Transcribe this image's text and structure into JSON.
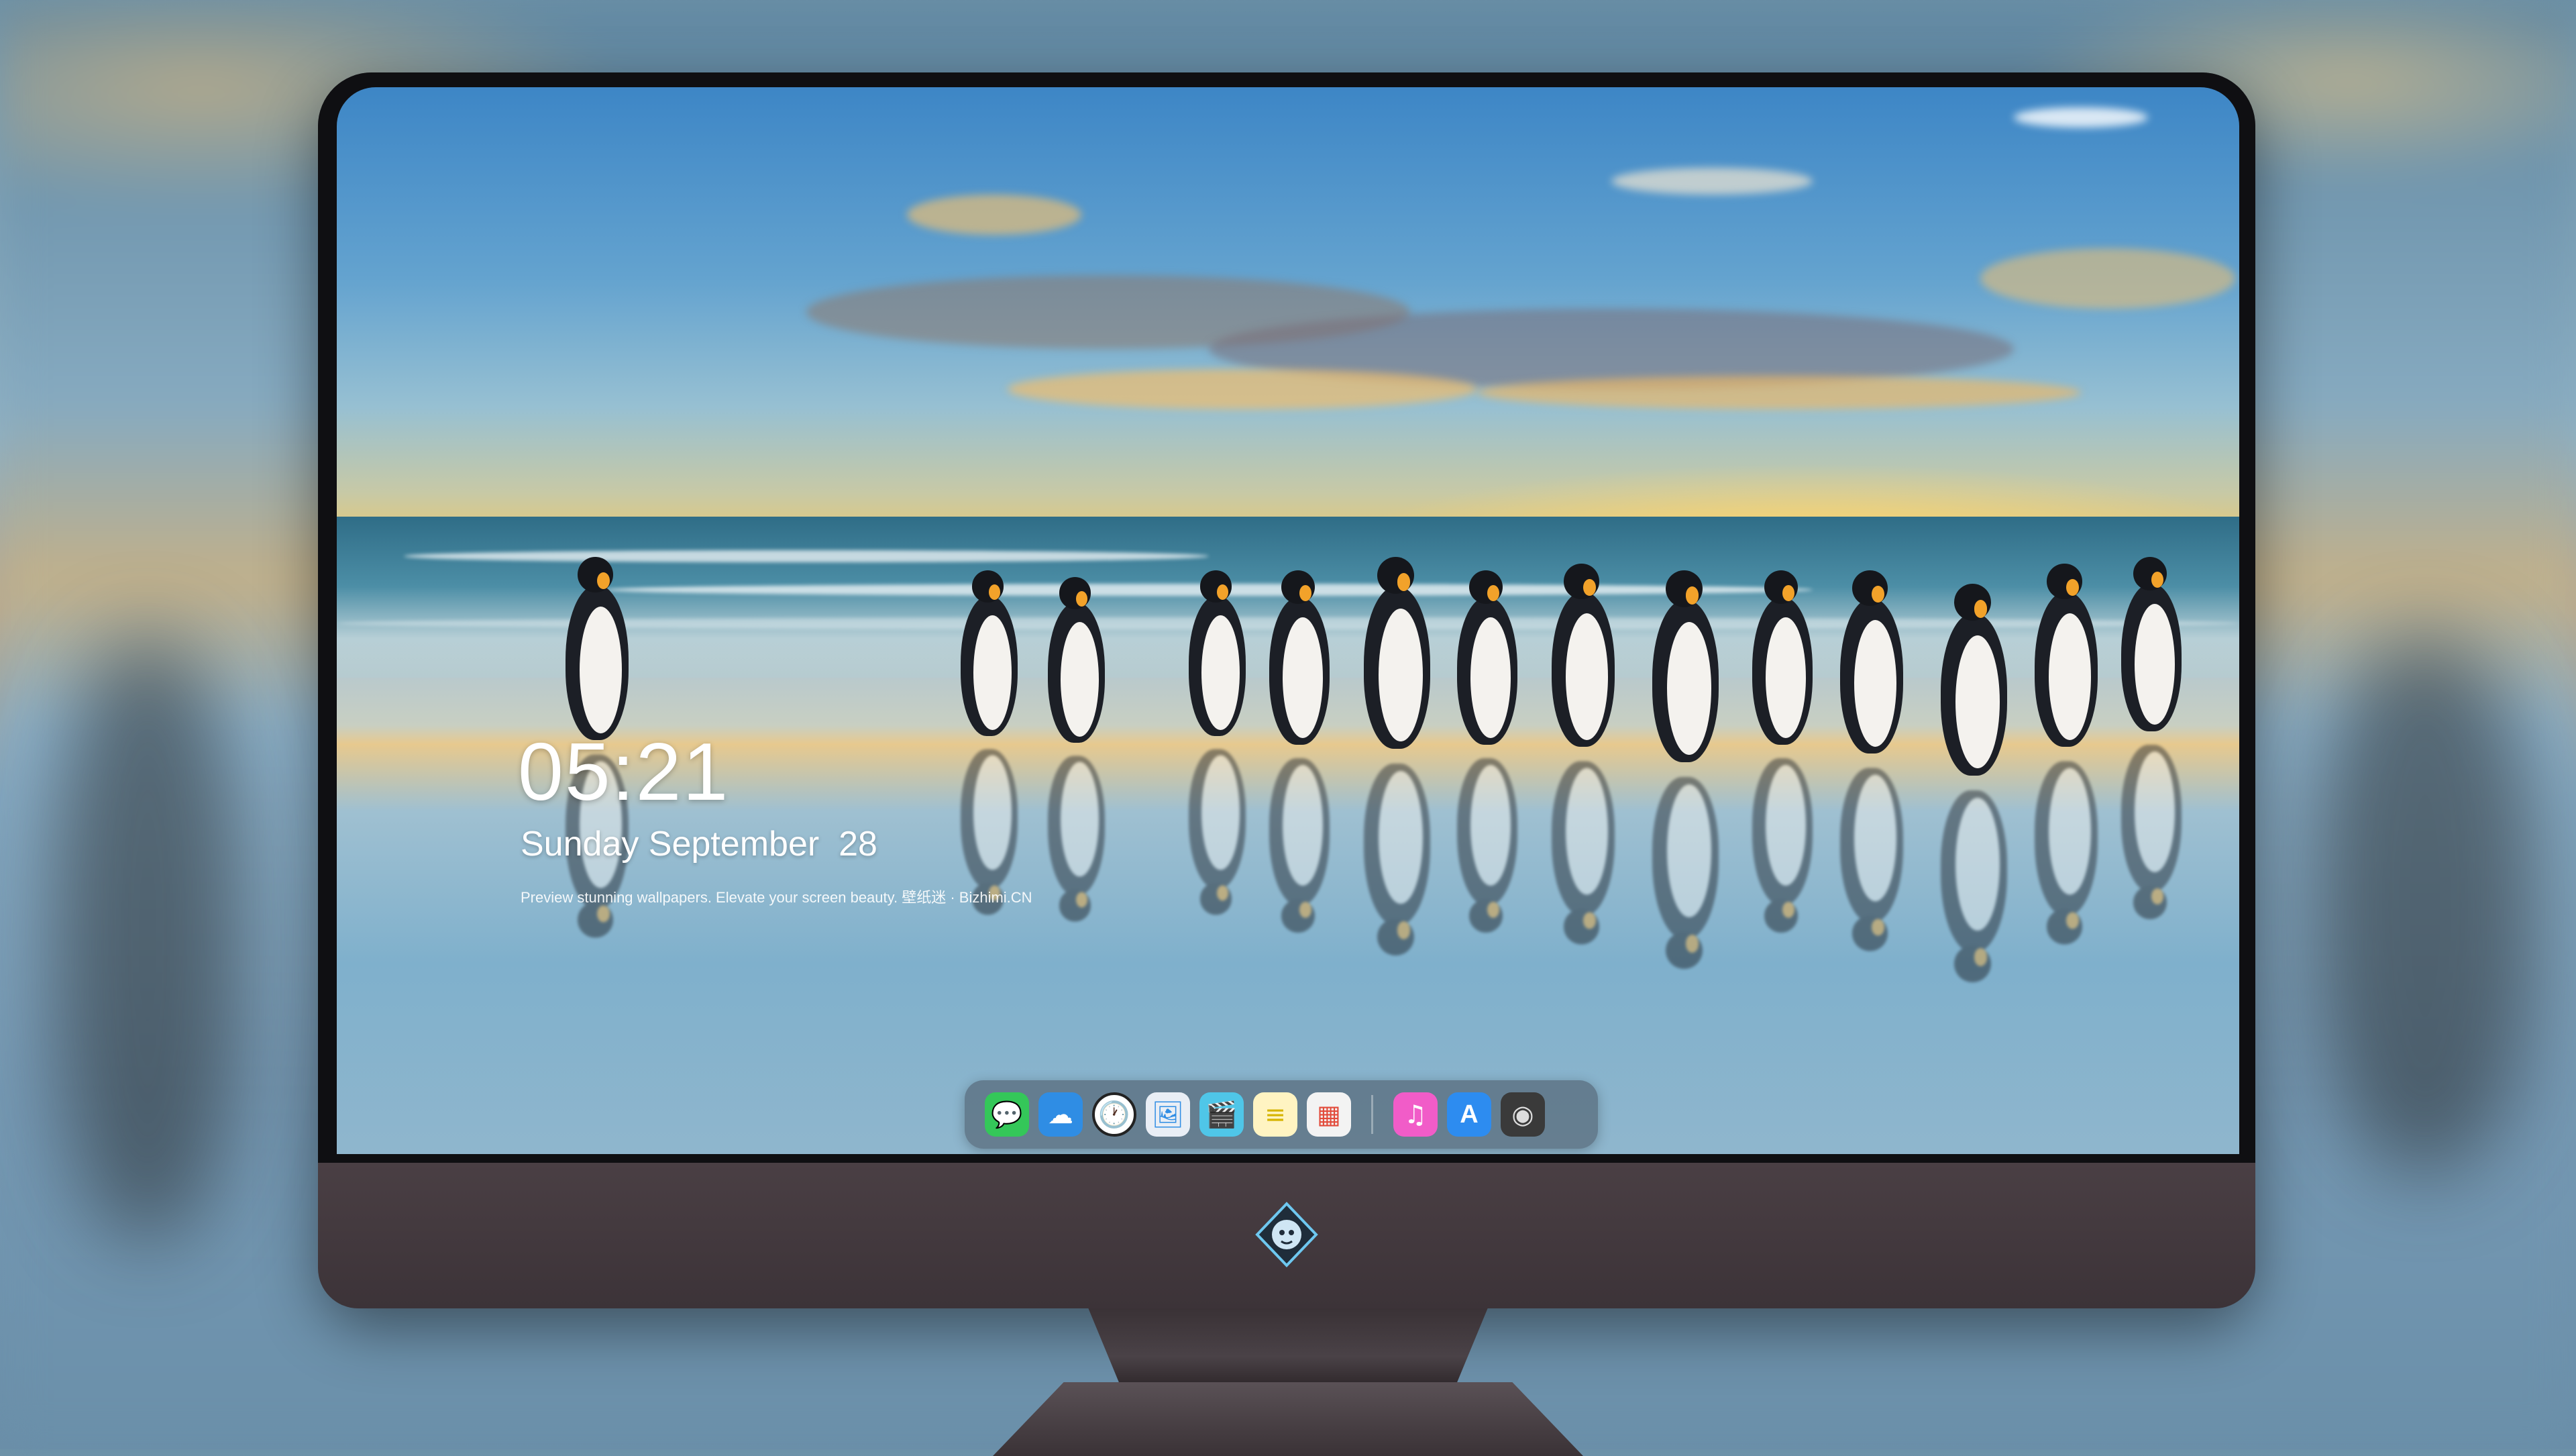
{
  "lock_screen": {
    "time": "05:21",
    "date": "Sunday September  28",
    "tagline": "Preview stunning wallpapers. Elevate your screen beauty. 壁纸迷 · Bizhimi.CN"
  },
  "dock": {
    "apps": [
      {
        "name": "messages-icon",
        "glyph": "💬",
        "color": "#34c759"
      },
      {
        "name": "weather-icon",
        "glyph": "☁",
        "color": "#2f8de4"
      },
      {
        "name": "clock-icon",
        "glyph": "🕐",
        "color": "#ffffff"
      },
      {
        "name": "preview-icon",
        "glyph": "🖼",
        "color": "#e9eef5"
      },
      {
        "name": "clips-icon",
        "glyph": "🎬",
        "color": "#4fc6e8"
      },
      {
        "name": "notes-icon",
        "glyph": "≡",
        "color": "#fff4c2"
      },
      {
        "name": "photo-booth-icon",
        "glyph": "▦",
        "color": "#f3f3f3"
      },
      {
        "name": "music-icon",
        "glyph": "♫",
        "color": "#f15cc8"
      },
      {
        "name": "app-store-icon",
        "glyph": "A",
        "color": "#2d8cf0"
      },
      {
        "name": "camera-icon",
        "glyph": "◉",
        "color": "#3a3a3a"
      }
    ]
  },
  "colors": {
    "bezel": "#0f0f12",
    "chin": "#4a3f44",
    "dock_bg": "rgba(70,80,95,0.55)"
  }
}
